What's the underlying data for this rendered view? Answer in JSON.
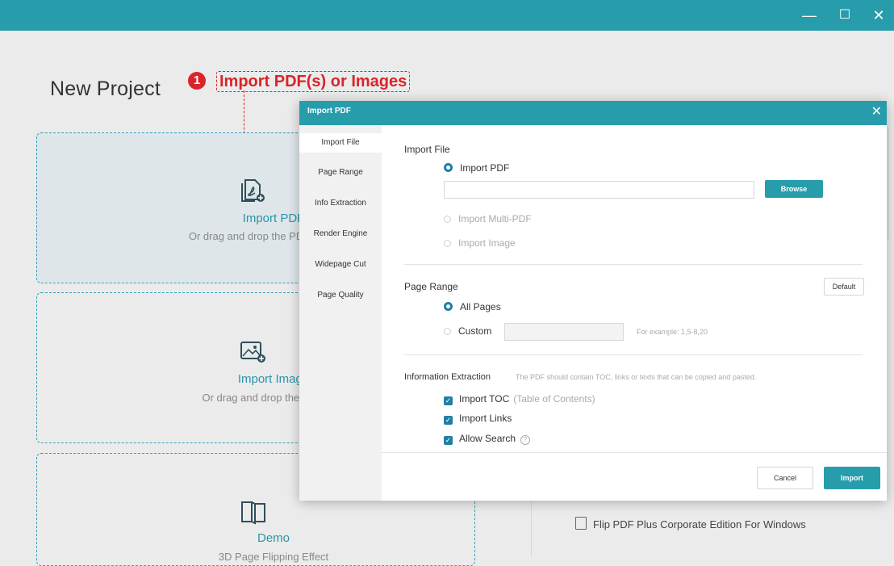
{
  "window": {
    "minimize_icon": "minimize-icon",
    "maximize_icon": "maximize-icon",
    "close_icon": "close-icon",
    "min_glyph": "—",
    "max_glyph": "☐",
    "close_glyph": "✕"
  },
  "page": {
    "title": "New Project"
  },
  "callout": {
    "number": "1",
    "text": "Import PDF(s) or Images"
  },
  "cards": [
    {
      "title": "Import PDF",
      "subtitle": "Or drag and drop the PDF here, size"
    },
    {
      "title": "Import Image",
      "subtitle": "Or drag and drop the images h"
    },
    {
      "title": "Demo",
      "subtitle": "3D Page Flipping Effect"
    }
  ],
  "right_panel": {
    "item": "Flip PDF Plus Corporate Edition For Windows"
  },
  "dialog": {
    "title": "Import PDF",
    "close_glyph": "✕",
    "sidebar": [
      "Import File",
      "Page Range",
      "Info Extraction",
      "Render Engine",
      "Widepage Cut",
      "Page Quality"
    ],
    "import_file": {
      "heading": "Import File",
      "opt_pdf": "Import PDF",
      "browse": "Browse",
      "opt_multi": "Import Multi-PDF",
      "opt_image": "Import Image",
      "path_value": ""
    },
    "page_range": {
      "heading": "Page Range",
      "default": "Default",
      "all": "All Pages",
      "custom": "Custom",
      "custom_value": "",
      "example": "For example: 1,5-8,20"
    },
    "info": {
      "heading": "Information Extraction",
      "hint": "The PDF should contain TOC, links or texts that can be copied and pasted.",
      "toc": "Import TOC",
      "toc_note": "(Table of Contents)",
      "links": "Import Links",
      "search": "Allow Search",
      "help_glyph": "?"
    },
    "footer": {
      "cancel": "Cancel",
      "import": "Import"
    }
  }
}
